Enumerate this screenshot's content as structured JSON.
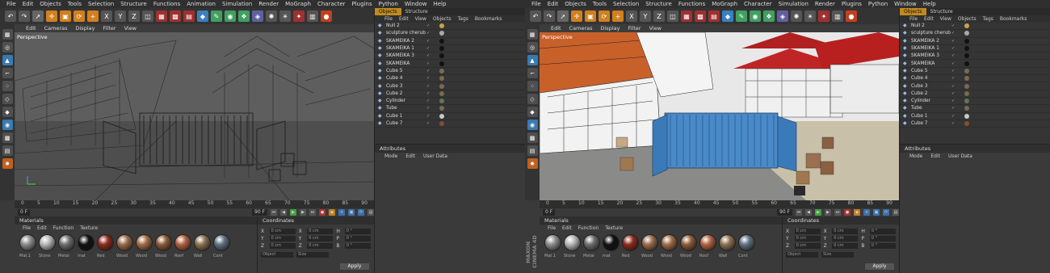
{
  "menus": [
    "File",
    "Edit",
    "Objects",
    "Tools",
    "Selection",
    "Structure",
    "Functions",
    "MoGraph",
    "Character",
    "Simulation",
    "Render",
    "Sculpt",
    "Pipeline",
    "Plugins",
    "Python",
    "Window",
    "Help"
  ],
  "menus_left": [
    "File",
    "Edit",
    "Objects",
    "Tools",
    "Selection",
    "Structure",
    "Functions",
    "Animation",
    "Simulation",
    "Render",
    "MoGraph",
    "Character",
    "Plugins",
    "Python",
    "Window",
    "Help"
  ],
  "viewport_menu": [
    "Edit",
    "Cameras",
    "Display",
    "Filter",
    "View"
  ],
  "viewport_label": "Perspective",
  "timeline": {
    "ticks": [
      "0",
      "5",
      "10",
      "15",
      "20",
      "25",
      "30",
      "35",
      "40",
      "45",
      "50",
      "55",
      "60",
      "65",
      "70",
      "75",
      "80",
      "85",
      "90"
    ],
    "start_field": "0 F",
    "end_field": "90 F",
    "current": "0 F"
  },
  "materials": {
    "title": "Materials",
    "menu": [
      "File",
      "Edit",
      "Function",
      "Texture"
    ],
    "items": [
      {
        "label": "Mat.1",
        "color": "#8a8a8a"
      },
      {
        "label": "Stone",
        "color": "#b5b5b5"
      },
      {
        "label": "Metal",
        "color": "#6c6c6c"
      },
      {
        "label": "mat",
        "color": "#111111"
      },
      {
        "label": "Red",
        "color": "#8c2a1c"
      },
      {
        "label": "Wood",
        "color": "#9a6a4a"
      },
      {
        "label": "Wood",
        "color": "#a06b45"
      },
      {
        "label": "Wood",
        "color": "#8a5a38"
      },
      {
        "label": "Roof",
        "color": "#b06040"
      },
      {
        "label": "Wall",
        "color": "#8a7050"
      },
      {
        "label": "Cont",
        "color": "#5f6f80"
      }
    ]
  },
  "coordinates": {
    "title": "Coordinates",
    "rows": [
      {
        "a": "X",
        "av": "0 cm",
        "b": "X",
        "bv": "0 cm",
        "c": "H",
        "cv": "0 °"
      },
      {
        "a": "Y",
        "av": "0 cm",
        "b": "Y",
        "bv": "0 cm",
        "c": "P",
        "cv": "0 °"
      },
      {
        "a": "Z",
        "av": "0 cm",
        "b": "Z",
        "bv": "0 cm",
        "c": "B",
        "cv": "0 °"
      }
    ],
    "mode1": "Object",
    "mode2": "Size",
    "apply": "Apply"
  },
  "objects_panel": {
    "tabs": [
      "Objects",
      "Structure"
    ],
    "menu": [
      "File",
      "Edit",
      "View",
      "Objects",
      "Tags",
      "Bookmarks"
    ],
    "items": [
      {
        "name": "Null 2",
        "tag": "#c8a24a"
      },
      {
        "name": "sculpture cherub",
        "tag": "#aaaaaa"
      },
      {
        "name": "SKAMEIKA 2",
        "tag": "#111111"
      },
      {
        "name": "SKAMEIKA 1",
        "tag": "#111111"
      },
      {
        "name": "SKAMEIKA 3",
        "tag": "#111111"
      },
      {
        "name": "SKAMEIKA",
        "tag": "#111111"
      },
      {
        "name": "Cube 5",
        "tag": "#7a6a50"
      },
      {
        "name": "Cube 4",
        "tag": "#7a6a50"
      },
      {
        "name": "Cube 3",
        "tag": "#7a6a50"
      },
      {
        "name": "Cube 2",
        "tag": "#7a6a50"
      },
      {
        "name": "Cylinder",
        "tag": "#5a7a50"
      },
      {
        "name": "Tube",
        "tag": "#7a6a50"
      },
      {
        "name": "Cube 1",
        "tag": "#c8c8c8"
      },
      {
        "name": "Cube 7",
        "tag": "#8a4a30"
      }
    ]
  },
  "attributes": {
    "title": "Attributes",
    "menu": [
      "Mode",
      "Edit",
      "User Data"
    ]
  },
  "brand": "MAXON CINEMA 4D",
  "colors": {
    "accent": "#c08a20",
    "roof_orange": "#c8602a",
    "roof_red": "#b02020",
    "container_blue": "#4a8ac8"
  }
}
